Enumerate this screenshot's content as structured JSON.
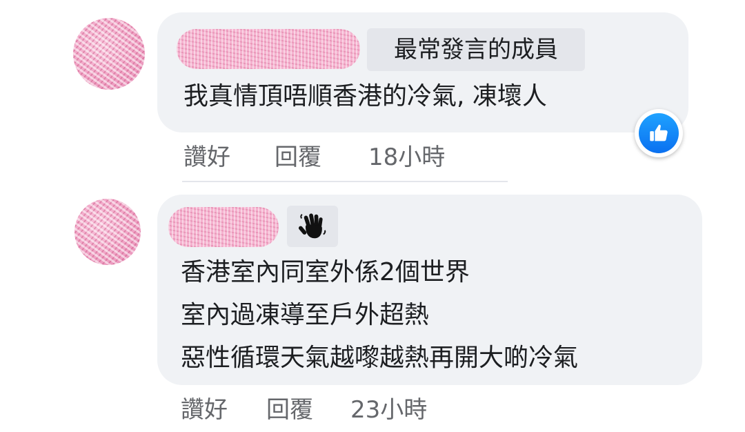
{
  "comments": [
    {
      "badge": "最常發言的成員",
      "lines": [
        "我真情頂唔順香港的冷氣, 凍壞人"
      ],
      "actions": {
        "like": "讚好",
        "reply": "回覆",
        "time": "18小時"
      },
      "reaction_icon": "like-thumb-icon"
    },
    {
      "badge_icon": "waving-hand-icon",
      "lines": [
        "香港室內同室外係2個世界",
        "室內過凍導至戶外超熱",
        "惡性循環天氣越嚟越熱再開大啲冷氣"
      ],
      "actions": {
        "like": "讚好",
        "reply": "回覆",
        "time": "23小時"
      }
    }
  ],
  "colors": {
    "bubble": "#f0f2f5",
    "text": "#1c1e21",
    "secondary_text": "#65676b",
    "like_blue": "#0a70f0"
  }
}
